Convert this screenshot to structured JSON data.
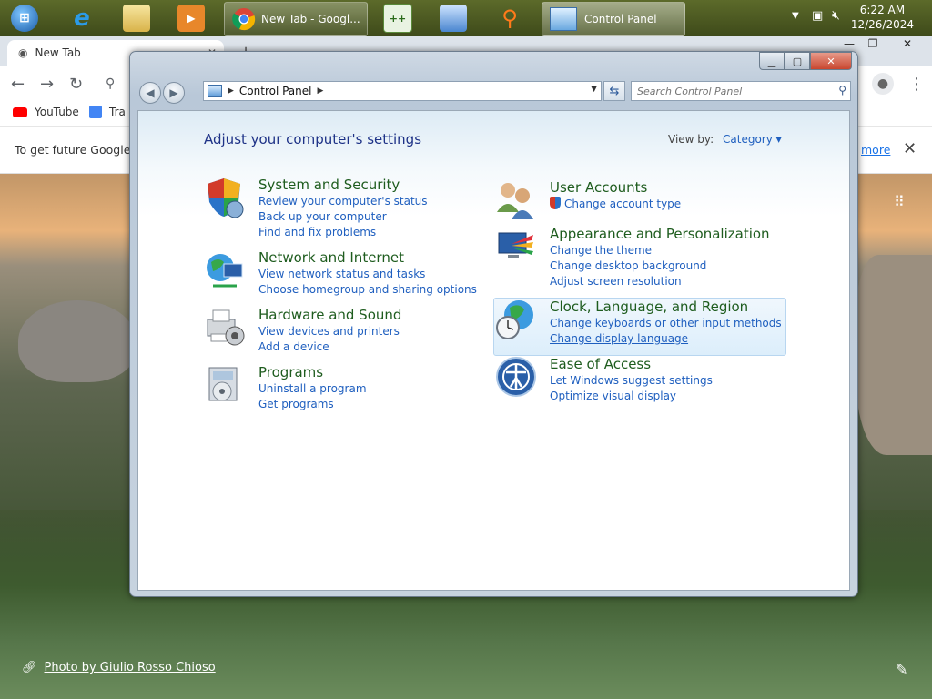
{
  "taskbar": {
    "tasks": [
      {
        "label": "New Tab - Googl..."
      },
      {
        "label": "Control Panel"
      }
    ],
    "clock_time": "6:22 AM",
    "clock_date": "12/26/2024"
  },
  "chrome": {
    "tab_title": "New Tab",
    "bookmarks": [
      {
        "label": "YouTube"
      },
      {
        "label": "Tra"
      }
    ],
    "infobar_message": "To get future Google C",
    "infobar_more": "more",
    "photo_credit": "Photo by Giulio Rosso Chioso"
  },
  "cp": {
    "address": "Control Panel",
    "search_placeholder": "Search Control Panel",
    "title": "Adjust your computer's settings",
    "viewby_label": "View by:",
    "viewby_value": "Category ▾",
    "left": [
      {
        "title": "System and Security",
        "links": [
          "Review your computer's status",
          "Back up your computer",
          "Find and fix problems"
        ]
      },
      {
        "title": "Network and Internet",
        "links": [
          "View network status and tasks",
          "Choose homegroup and sharing options"
        ]
      },
      {
        "title": "Hardware and Sound",
        "links": [
          "View devices and printers",
          "Add a device"
        ]
      },
      {
        "title": "Programs",
        "links": [
          "Uninstall a program",
          "Get programs"
        ]
      }
    ],
    "right": [
      {
        "title": "User Accounts",
        "links": [
          "Change account type"
        ]
      },
      {
        "title": "Appearance and Personalization",
        "links": [
          "Change the theme",
          "Change desktop background",
          "Adjust screen resolution"
        ]
      },
      {
        "title": "Clock, Language, and Region",
        "links": [
          "Change keyboards or other input methods",
          "Change display language"
        ]
      },
      {
        "title": "Ease of Access",
        "links": [
          "Let Windows suggest settings",
          "Optimize visual display"
        ]
      }
    ]
  }
}
